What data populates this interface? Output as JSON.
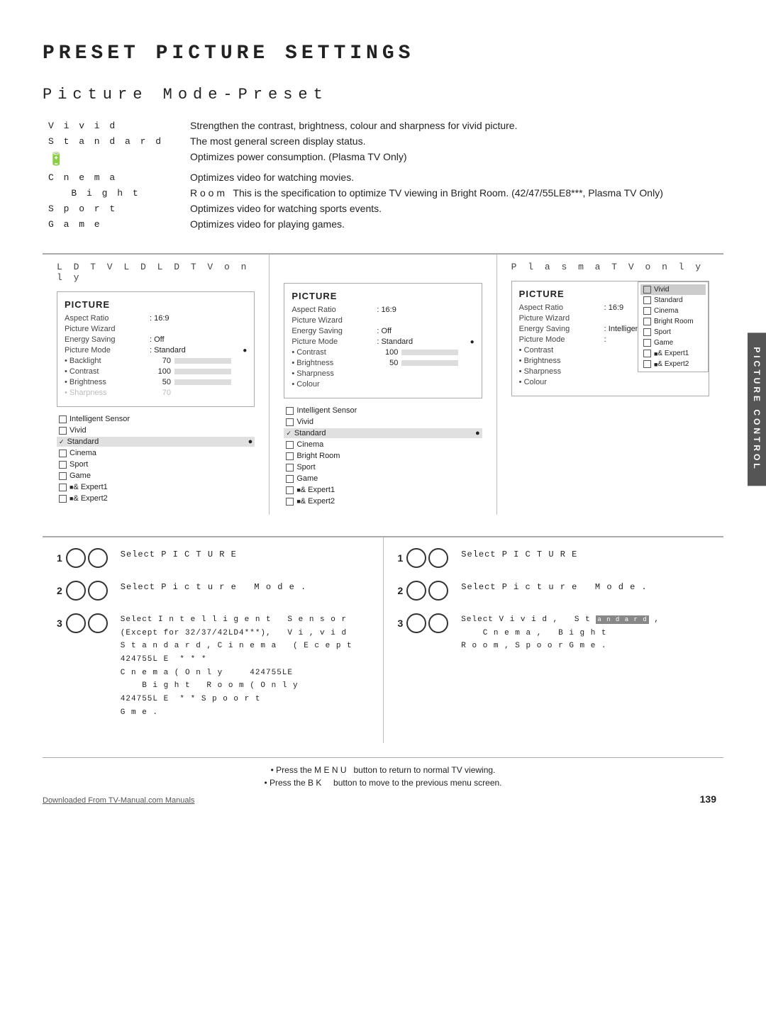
{
  "page": {
    "main_title": "PRESET PICTURE SETTINGS",
    "section_title": "Picture  Mode-Preset",
    "modes": [
      {
        "name": "V i v i d",
        "desc": "Strengthen the contrast, brightness, colour and sharpness for vivid picture."
      },
      {
        "name": "S t a n d a r d",
        "desc": "The most general screen display status."
      },
      {
        "name": "",
        "desc": "Optimizes power consumption. (Plasma TV Only)"
      },
      {
        "name": "C n e m a",
        "desc": "Optimizes video for watching movies."
      },
      {
        "name": "  B i g h t",
        "desc": "R o o m  This is the specification to optimize TV viewing in Bright Room. (42/47/55LE8***, Plasma TV Only)"
      },
      {
        "name": "S p o r t",
        "desc": "Optimizes video for watching sports events."
      },
      {
        "name": "G a m e",
        "desc": "Optimizes video for playing games."
      }
    ],
    "lcd_header": "L D T V L D L D T V  o n l y",
    "plasma_header": "P l a s m a   T V  o n l y",
    "picture_label": "PICTURE",
    "aspect_label": "Aspect Ratio",
    "aspect_value": ": 16:9",
    "wizard_label": "Picture Wizard",
    "energy_label": "Energy Saving",
    "energy_value": ": Off",
    "energy_value_right": ": Intelligent Se",
    "picture_mode_label": "Picture Mode",
    "picture_mode_value": ": Standard",
    "backlight_label": "• Backlight",
    "backlight_value": "70",
    "contrast_label": "• Contrast",
    "contrast_value": "100",
    "brightness_label": "• Brightness",
    "brightness_value": "50",
    "sharpness_label": "• Sharpness",
    "sharpness_value": "70",
    "colour_label": "• Colour",
    "lcd_modes": [
      {
        "label": "Intelligent Sensor",
        "type": "checkbox",
        "checked": false
      },
      {
        "label": "Vivid",
        "type": "checkbox",
        "checked": false
      },
      {
        "label": "Standard",
        "type": "check",
        "checked": true,
        "selected": true
      },
      {
        "label": "Cinema",
        "type": "checkbox",
        "checked": false
      },
      {
        "label": "Sport",
        "type": "checkbox",
        "checked": false
      },
      {
        "label": "Game",
        "type": "checkbox",
        "checked": false
      },
      {
        "label": "& Expert1",
        "type": "checkbox2",
        "checked": false
      },
      {
        "label": "& Expert2",
        "type": "checkbox2",
        "checked": false
      }
    ],
    "lcd2_modes": [
      {
        "label": "Intelligent Sensor",
        "type": "checkbox",
        "checked": false
      },
      {
        "label": "Vivid",
        "type": "checkbox",
        "checked": false
      },
      {
        "label": "Standard",
        "type": "check",
        "checked": true,
        "selected": true
      },
      {
        "label": "Cinema",
        "type": "checkbox",
        "checked": false
      },
      {
        "label": "Bright Room",
        "type": "checkbox",
        "checked": false
      },
      {
        "label": "Sport",
        "type": "checkbox",
        "checked": false
      },
      {
        "label": "Game",
        "type": "checkbox",
        "checked": false
      },
      {
        "label": "& Expert1",
        "type": "checkbox2",
        "checked": false
      },
      {
        "label": "& Expert2",
        "type": "checkbox2",
        "checked": false
      }
    ],
    "plasma_modes": [
      {
        "label": "Vivid",
        "type": "checkbox",
        "checked": false,
        "selected": true
      },
      {
        "label": "Standard",
        "type": "checkbox",
        "checked": false
      },
      {
        "label": "Cinema",
        "type": "checkbox",
        "checked": false
      },
      {
        "label": "Bright Room",
        "type": "checkbox",
        "checked": false
      },
      {
        "label": "Sport",
        "type": "checkbox",
        "checked": false
      },
      {
        "label": "Game",
        "type": "checkbox",
        "checked": false
      },
      {
        "label": "& Expert1",
        "type": "checkbox2",
        "checked": false
      },
      {
        "label": "& Expert2",
        "type": "checkbox2",
        "checked": false
      }
    ],
    "steps_lcd": [
      {
        "number": "1",
        "text": "Select P I C T U R E"
      },
      {
        "number": "2",
        "text": "Select P i c t u r e   M o d e ."
      },
      {
        "number": "3",
        "text": "Select I n t e l l i g e n t  S e n s o r\n(Except for 32/37/42LD4***),  V i , v i d\nS t a n d a r d , C i n e m a  ( E c e p t\n424755LE * * *\nC n e m a ( O n l y   424755LE\n  B i g h t   R o o m ( O n l y\n424755LE * * S p o o r t\nG m e ."
      }
    ],
    "steps_plasma": [
      {
        "number": "1",
        "text": "Select P I C T U R E"
      },
      {
        "number": "2",
        "text": "Select P i c t u r e   M o d e ."
      },
      {
        "number": "3",
        "text": "Select V i v i d ,  S t a n d a r d ,\n  C n e m a ,  B i g h t\nR o o m , S p o o r G m e ."
      }
    ],
    "notes": [
      "• Press the M E N U  button to return to normal TV viewing.",
      "• Press the B K   button to move to the previous menu screen."
    ],
    "side_tab": "PICTURE CONTROL",
    "page_number": "139",
    "footer_link": "Downloaded From TV-Manual.com Manuals"
  }
}
